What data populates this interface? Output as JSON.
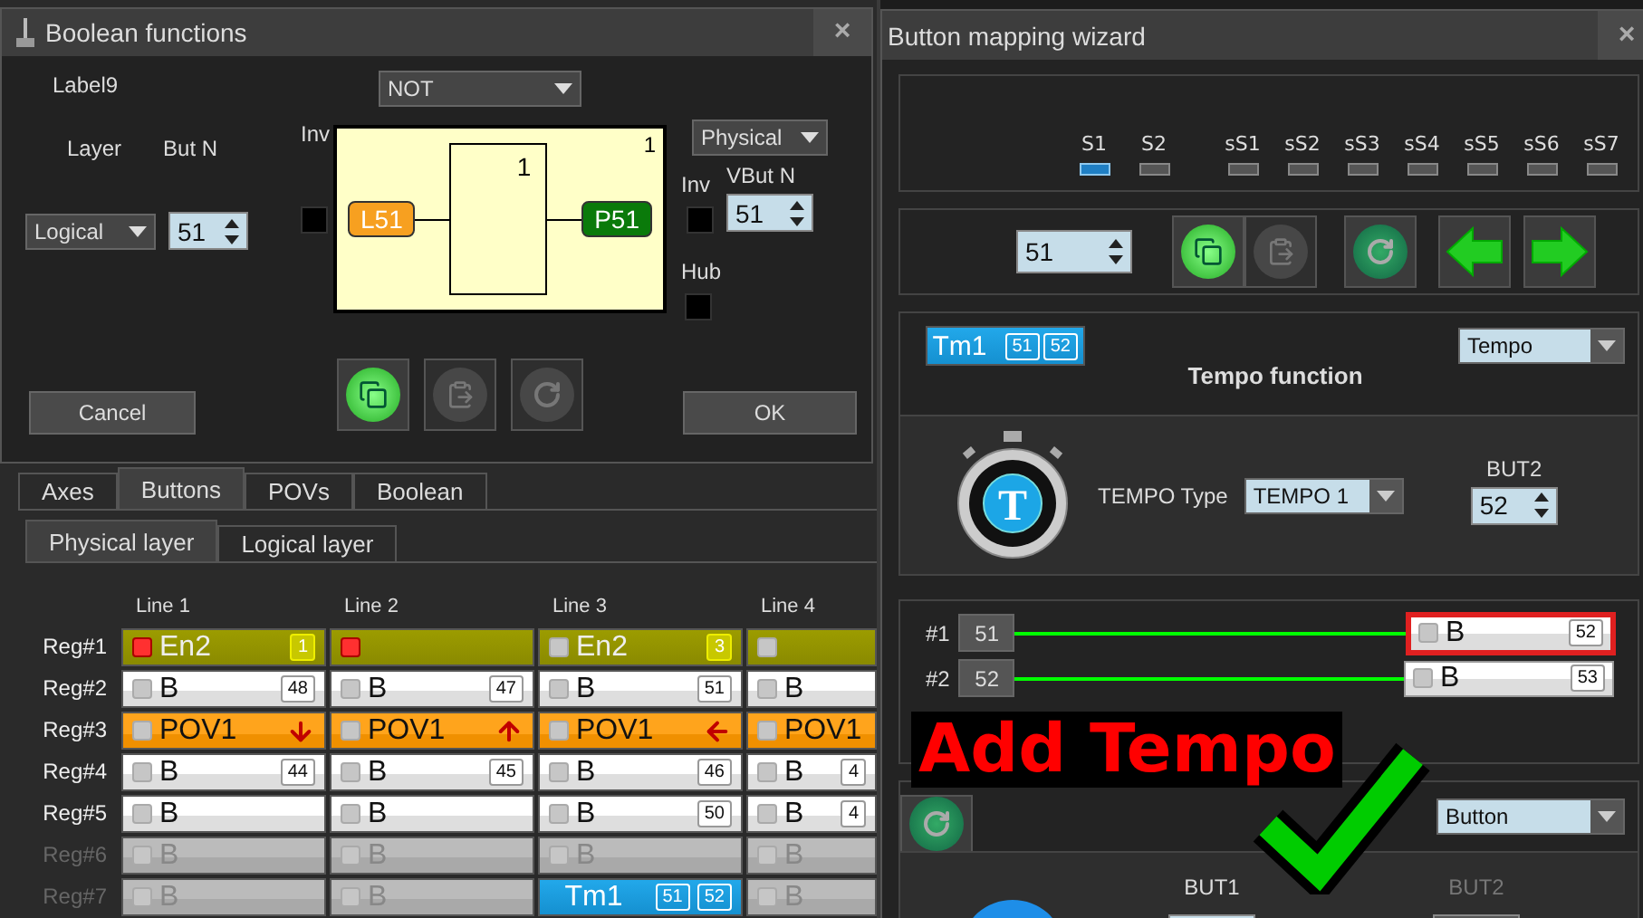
{
  "boolean_dialog": {
    "title": "Boolean functions",
    "close": "×",
    "label": "Label9",
    "function": "NOT",
    "layer_heading": "Layer",
    "but_heading": "But N",
    "layer": "Logical",
    "but_n": "51",
    "inv_in": {
      "label": "Inv",
      "checked": false
    },
    "diagram": {
      "corner": "1",
      "gate": "1",
      "input": "L51",
      "output": "P51"
    },
    "output_layer": "Physical",
    "inv_out": {
      "label": "Inv",
      "checked": false
    },
    "vbut_heading": "VBut N",
    "vbut_n": "51",
    "hub": {
      "label": "Hub",
      "checked": false
    },
    "tools": [
      {
        "kind": "copy",
        "disabled": false
      },
      {
        "kind": "paste",
        "disabled": true
      },
      {
        "kind": "reset",
        "disabled": true
      }
    ],
    "cancel": "Cancel",
    "ok": "OK"
  },
  "tabs": [
    {
      "label": "Axes",
      "selected": false
    },
    {
      "label": "Buttons",
      "selected": true
    },
    {
      "label": "POVs",
      "selected": false
    },
    {
      "label": "Boolean",
      "selected": false
    }
  ],
  "layer_tabs": [
    {
      "label": "Physical layer",
      "selected": true
    },
    {
      "label": "Logical layer",
      "selected": false
    }
  ],
  "grid": {
    "columns": [
      "Line 1",
      "Line 2",
      "Line 3",
      "Line 4"
    ],
    "rows": [
      {
        "label": "Reg#1",
        "disabled": false,
        "cells": [
          {
            "kind": "enable",
            "label": "En2",
            "badge": "1",
            "active": true
          },
          {
            "kind": "enable",
            "active": true
          },
          {
            "kind": "enable",
            "label": "En2",
            "badge": "3",
            "active": false
          },
          {
            "kind": "enable",
            "active": false
          }
        ]
      },
      {
        "label": "Reg#2",
        "disabled": false,
        "cells": [
          {
            "kind": "button",
            "label": "B",
            "badge": "48"
          },
          {
            "kind": "button",
            "label": "B",
            "badge": "47"
          },
          {
            "kind": "button",
            "label": "B",
            "badge": "51"
          },
          {
            "kind": "button",
            "label": "B"
          }
        ]
      },
      {
        "label": "Reg#3",
        "disabled": false,
        "cells": [
          {
            "kind": "pov",
            "label": "POV1",
            "arrow": {
              "kind": "down"
            }
          },
          {
            "kind": "pov",
            "label": "POV1",
            "arrow": {
              "kind": "up"
            }
          },
          {
            "kind": "pov",
            "label": "POV1",
            "arrow": {
              "kind": "left"
            }
          },
          {
            "kind": "pov",
            "label": "POV1"
          }
        ]
      },
      {
        "label": "Reg#4",
        "disabled": false,
        "cells": [
          {
            "kind": "button",
            "label": "B",
            "badge": "44"
          },
          {
            "kind": "button",
            "label": "B",
            "badge": "45"
          },
          {
            "kind": "button",
            "label": "B",
            "badge": "46"
          },
          {
            "kind": "button",
            "label": "B",
            "badge": "4"
          }
        ]
      },
      {
        "label": "Reg#5",
        "disabled": false,
        "cells": [
          {
            "kind": "button",
            "label": "B"
          },
          {
            "kind": "button",
            "label": "B"
          },
          {
            "kind": "button",
            "label": "B",
            "badge": "50"
          },
          {
            "kind": "button",
            "label": "B",
            "badge": "4"
          }
        ]
      },
      {
        "label": "Reg#6",
        "disabled": true,
        "cells": [
          {
            "kind": "button",
            "label": "B"
          },
          {
            "kind": "button",
            "label": "B"
          },
          {
            "kind": "button",
            "label": "B"
          },
          {
            "kind": "button",
            "label": "B"
          }
        ]
      },
      {
        "label": "Reg#7",
        "disabled": true,
        "cells": [
          {
            "kind": "button",
            "label": "B"
          },
          {
            "kind": "button",
            "label": "B"
          },
          {
            "kind": "tempo",
            "label": "Tm1",
            "badges": [
              "51",
              "52"
            ]
          },
          {
            "kind": "button",
            "label": "B"
          }
        ]
      }
    ]
  },
  "wizard": {
    "title": "Button mapping wizard",
    "close": "×",
    "switches": [
      {
        "label": "S1",
        "selected": true
      },
      {
        "label": "S2",
        "selected": false
      }
    ],
    "sub_switches": [
      {
        "label": "sS1",
        "selected": false
      },
      {
        "label": "sS2",
        "selected": false
      },
      {
        "label": "sS3",
        "selected": false
      },
      {
        "label": "sS4",
        "selected": false
      },
      {
        "label": "sS5",
        "selected": false
      },
      {
        "label": "sS6",
        "selected": false
      },
      {
        "label": "sS7",
        "selected": false
      }
    ],
    "number": "51",
    "tools": [
      {
        "kind": "copy",
        "disabled": false
      },
      {
        "kind": "paste",
        "disabled": true
      },
      {
        "kind": "reset",
        "disabled": false
      },
      {
        "kind": "back",
        "disabled": false
      },
      {
        "kind": "forward",
        "disabled": false
      }
    ],
    "tempo": {
      "chip": {
        "label": "Tm1",
        "badges": [
          "51",
          "52"
        ]
      },
      "mode": "Tempo",
      "title": "Tempo function",
      "letter": "T",
      "type_label": "TEMPO Type",
      "type": "TEMPO 1",
      "but_label": "BUT2",
      "but": "52"
    },
    "mapping": [
      {
        "index": "#1",
        "value": "51",
        "target": "B",
        "badge": "52",
        "highlighted": true
      },
      {
        "index": "#2",
        "value": "52",
        "target": "B",
        "badge": "53",
        "highlighted": false
      }
    ],
    "callout": "Add Tempo",
    "bottom": {
      "mode": "Button",
      "fields": [
        {
          "label": "BUT1",
          "disabled": false
        },
        {
          "label": "BUT2",
          "disabled": true
        }
      ]
    }
  }
}
